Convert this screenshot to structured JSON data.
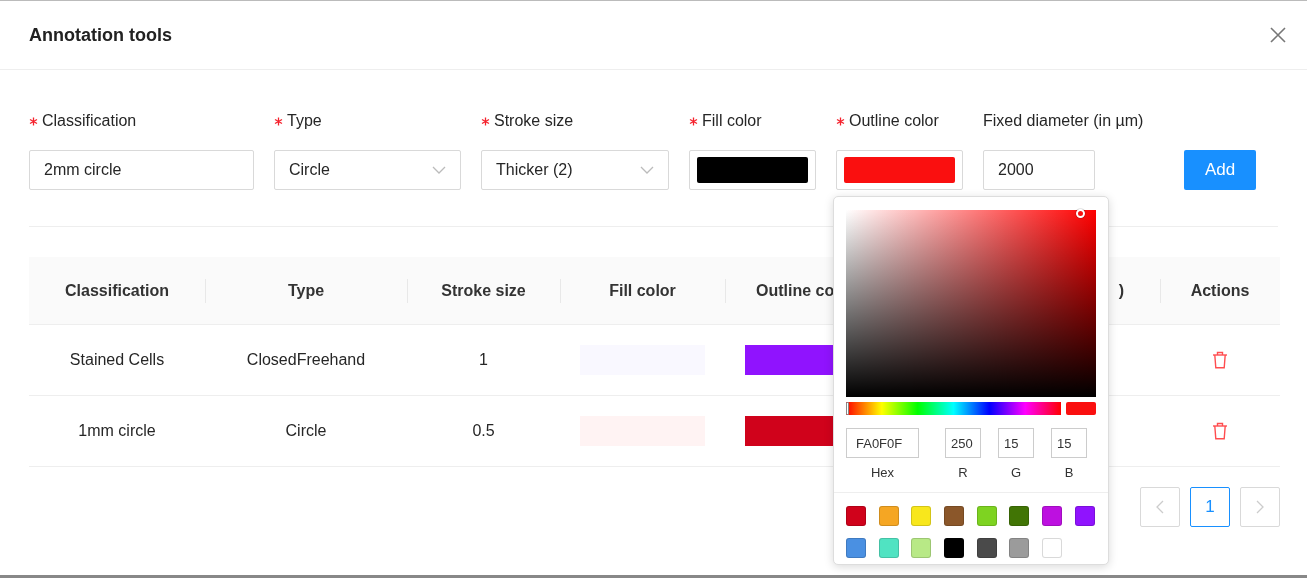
{
  "dialog": {
    "title": "Annotation tools"
  },
  "form": {
    "fields": [
      {
        "kind": "text",
        "label": "Classification",
        "required": true,
        "value": "2mm circle"
      },
      {
        "kind": "select",
        "label": "Type",
        "required": true,
        "value": "Circle"
      },
      {
        "kind": "select",
        "label": "Stroke size",
        "required": true,
        "value": "Thicker (2)"
      },
      {
        "kind": "color",
        "label": "Fill color",
        "required": true,
        "color": "#000000"
      },
      {
        "kind": "color",
        "label": "Outline color",
        "required": true,
        "color": "#fa0f0f"
      },
      {
        "kind": "text",
        "label": "Fixed diameter (in µm)",
        "required": false,
        "value": "2000"
      }
    ],
    "add_button": "Add"
  },
  "table": {
    "columns": [
      "Classification",
      "Type",
      "Stroke size",
      "Fill color",
      "Outline co",
      ")",
      "Actions"
    ],
    "rows": [
      {
        "classification": "Stained Cells",
        "type": "ClosedFreehand",
        "stroke_size": "1",
        "fill": {
          "color": "#f9f8ff"
        },
        "outline": {
          "color": "#9013fe"
        }
      },
      {
        "classification": "1mm circle",
        "type": "Circle",
        "stroke_size": "0.5",
        "fill": {
          "color": "#fff3f3"
        },
        "outline": {
          "color": "#d0021b"
        }
      }
    ]
  },
  "pagination": {
    "pages": [
      {
        "label": "1",
        "selected": true
      }
    ],
    "prev_disabled": true,
    "next_disabled": true
  },
  "color_picker": {
    "hue_slider": {
      "level": 0
    },
    "color": "#fa0f0f",
    "hex": "FA0F0F",
    "r": "250",
    "g": "15",
    "b": "15",
    "labels": [
      "Hex",
      "R",
      "G",
      "B"
    ],
    "presets": [
      {
        "color": "#d0021b"
      },
      {
        "color": "#f5a623"
      },
      {
        "color": "#f8e71c"
      },
      {
        "color": "#8b572a"
      },
      {
        "color": "#7ed321"
      },
      {
        "color": "#417505"
      },
      {
        "color": "#bd10e0"
      },
      {
        "color": "#9013fe"
      },
      {
        "color": "#4a90e2"
      },
      {
        "color": "#50e3c2"
      },
      {
        "color": "#b8e986"
      },
      {
        "color": "#000000"
      },
      {
        "color": "#4a4a4a"
      },
      {
        "color": "#9b9b9b"
      },
      {
        "color": "#ffffff"
      }
    ]
  }
}
